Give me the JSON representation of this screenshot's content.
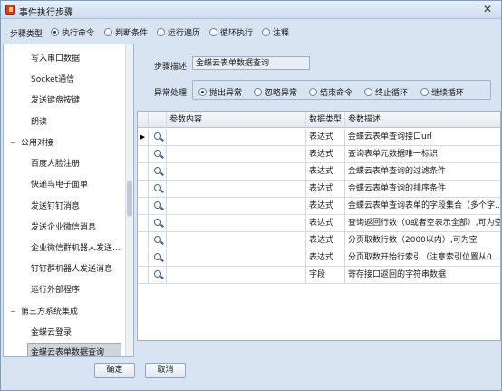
{
  "window": {
    "title": "事件执行步骤"
  },
  "step_type": {
    "label": "步骤类型",
    "options": [
      "执行命令",
      "判断条件",
      "运行遍历",
      "循环执行",
      "注释"
    ],
    "selected": "执行命令"
  },
  "sidebar": {
    "items": [
      {
        "label": "写入串口数据",
        "kind": "child"
      },
      {
        "label": "Socket通信",
        "kind": "child"
      },
      {
        "label": "发送键盘按键",
        "kind": "child"
      },
      {
        "label": "朗读",
        "kind": "child"
      },
      {
        "label": "公用对接",
        "kind": "group"
      },
      {
        "label": "百度人脸注册",
        "kind": "child"
      },
      {
        "label": "快递鸟电子面单",
        "kind": "child"
      },
      {
        "label": "发送钉钉消息",
        "kind": "child"
      },
      {
        "label": "发送企业微信消息",
        "kind": "child"
      },
      {
        "label": "企业微信群机器人发送...",
        "kind": "child"
      },
      {
        "label": "钉钉群机器人发送消息",
        "kind": "child"
      },
      {
        "label": "运行外部程序",
        "kind": "child"
      },
      {
        "label": "第三方系统集成",
        "kind": "group"
      },
      {
        "label": "金蝶云登录",
        "kind": "child"
      },
      {
        "label": "金蝶云表单数据查询",
        "kind": "child",
        "selected": true
      }
    ]
  },
  "form": {
    "desc_label": "步骤描述",
    "desc_value": "金蝶云表单数据查询",
    "exception_label": "异常处理",
    "exception_options": [
      "抛出异常",
      "忽略异常",
      "结束命令",
      "终止循环",
      "继续循环"
    ],
    "exception_selected": "抛出异常"
  },
  "grid": {
    "headers": [
      "参数内容",
      "数据类型",
      "参数描述"
    ],
    "rows": [
      {
        "content": "",
        "type": "表达式",
        "desc": "金蝶云表单查询接口url"
      },
      {
        "content": "",
        "type": "表达式",
        "desc": "查询表单元数据唯一标识"
      },
      {
        "content": "",
        "type": "表达式",
        "desc": "金蝶云表单查询的过滤条件"
      },
      {
        "content": "",
        "type": "表达式",
        "desc": "金蝶云表单查询的排序条件"
      },
      {
        "content": "",
        "type": "表达式",
        "desc": "金蝶云表单查询表单的字段集合（多个字..."
      },
      {
        "content": "",
        "type": "表达式",
        "desc": "查询返回行数（0或者空表示全部）,可为空"
      },
      {
        "content": "",
        "type": "表达式",
        "desc": "分页取数行数（2000以内）,可为空"
      },
      {
        "content": "",
        "type": "表达式",
        "desc": "分页取数开始行索引（注意索引位置从0..."
      },
      {
        "content": "",
        "type": "字段",
        "desc": "寄存接口返回的字符串数据"
      }
    ],
    "current_row_marker": "▶"
  },
  "buttons": {
    "ok": "确定",
    "cancel": "取消"
  },
  "colors": {
    "window_bg": "#d9e4f3",
    "selected_item": "#cfd5dd"
  }
}
